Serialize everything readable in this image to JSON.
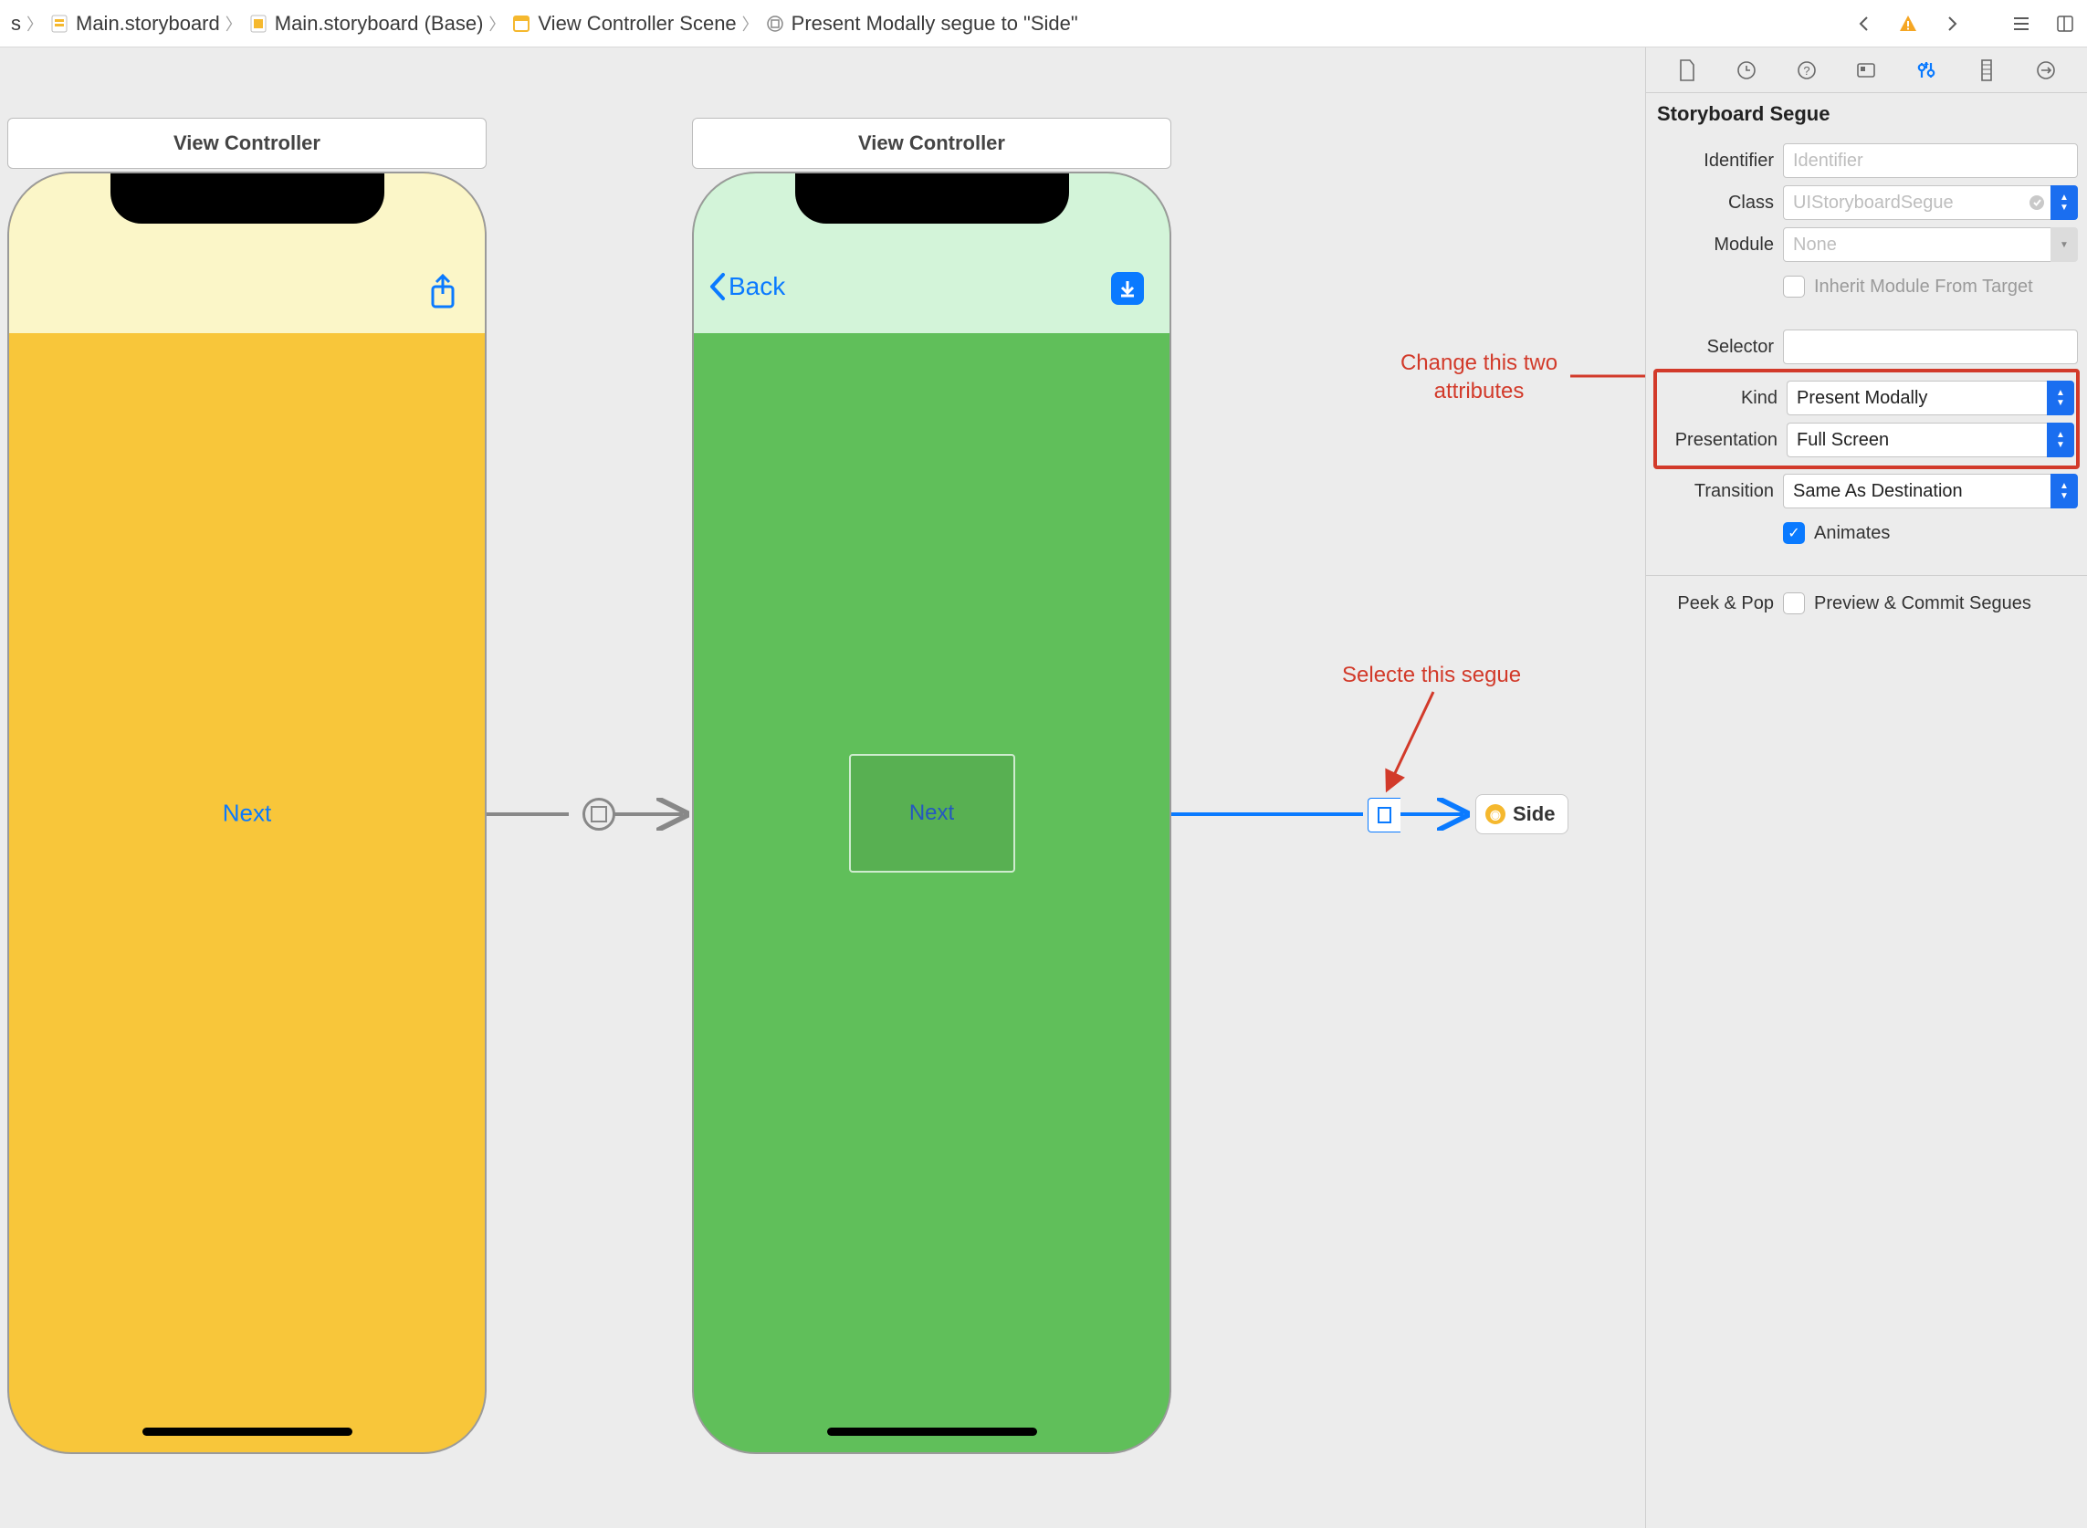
{
  "breadcrumb": {
    "item0_suffix": "s",
    "item1": "Main.storyboard",
    "item2": "Main.storyboard (Base)",
    "item3": "View Controller Scene",
    "item4": "Present Modally segue to \"Side\""
  },
  "scenes": {
    "left_title": "View Controller",
    "right_title": "View Controller",
    "left_button": "Next",
    "right_button": "Next",
    "back_label": "Back",
    "side_chip": "Side"
  },
  "annotations": {
    "attrs_line1": "Change this two",
    "attrs_line2": "attributes",
    "segue": "Selecte this segue"
  },
  "inspector": {
    "section": "Storyboard Segue",
    "rows": {
      "identifier_label": "Identifier",
      "identifier_placeholder": "Identifier",
      "class_label": "Class",
      "class_value": "UIStoryboardSegue",
      "module_label": "Module",
      "module_value": "None",
      "inherit_label": "Inherit Module From Target",
      "selector_label": "Selector",
      "kind_label": "Kind",
      "kind_value": "Present Modally",
      "presentation_label": "Presentation",
      "presentation_value": "Full Screen",
      "transition_label": "Transition",
      "transition_value": "Same As Destination",
      "animates_label": "Animates",
      "peekpop_label": "Peek & Pop",
      "peekpop_value": "Preview & Commit Segues"
    }
  }
}
